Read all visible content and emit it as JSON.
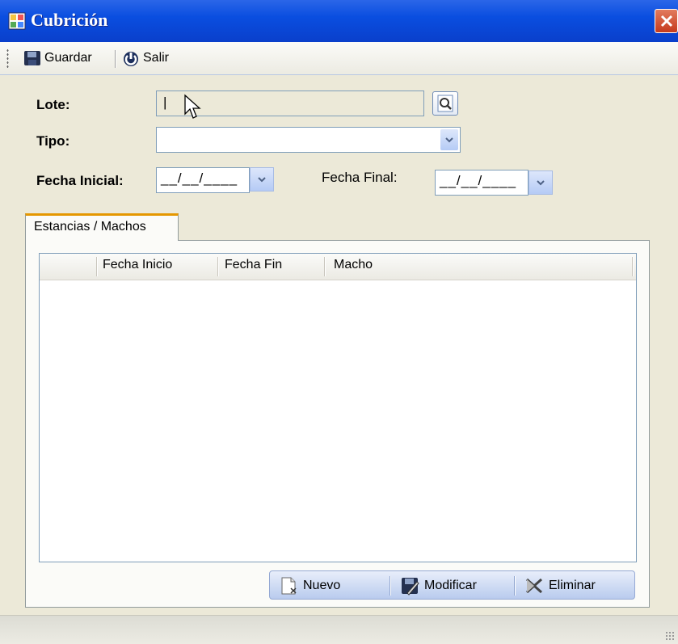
{
  "window": {
    "title": "Cubrición"
  },
  "toolbar": {
    "save_label": "Guardar",
    "exit_label": "Salir"
  },
  "form": {
    "lote_label": "Lote:",
    "lote_value": "|",
    "tipo_label": "Tipo:",
    "tipo_value": "",
    "fecha_inicial_label": "Fecha Inicial:",
    "fecha_inicial_value": "__/__/____",
    "fecha_final_label": "Fecha Final:",
    "fecha_final_value": "__/__/____"
  },
  "tabs": [
    {
      "label": "Estancias / Machos"
    }
  ],
  "grid": {
    "columns": [
      "Fecha Inicio",
      "Fecha Fin",
      "Macho"
    ],
    "rows": []
  },
  "actions": {
    "new_label": "Nuevo",
    "edit_label": "Modificar",
    "delete_label": "Eliminar"
  },
  "colors": {
    "titlebar": "#0a4ee0",
    "tab_accent": "#e59700",
    "panel": "#ece9d8"
  },
  "icons": [
    "app-icon",
    "close-icon",
    "save-icon",
    "power-icon",
    "lookup-icon",
    "chevron-down-icon",
    "new-document-icon",
    "edit-icon",
    "delete-icon"
  ]
}
